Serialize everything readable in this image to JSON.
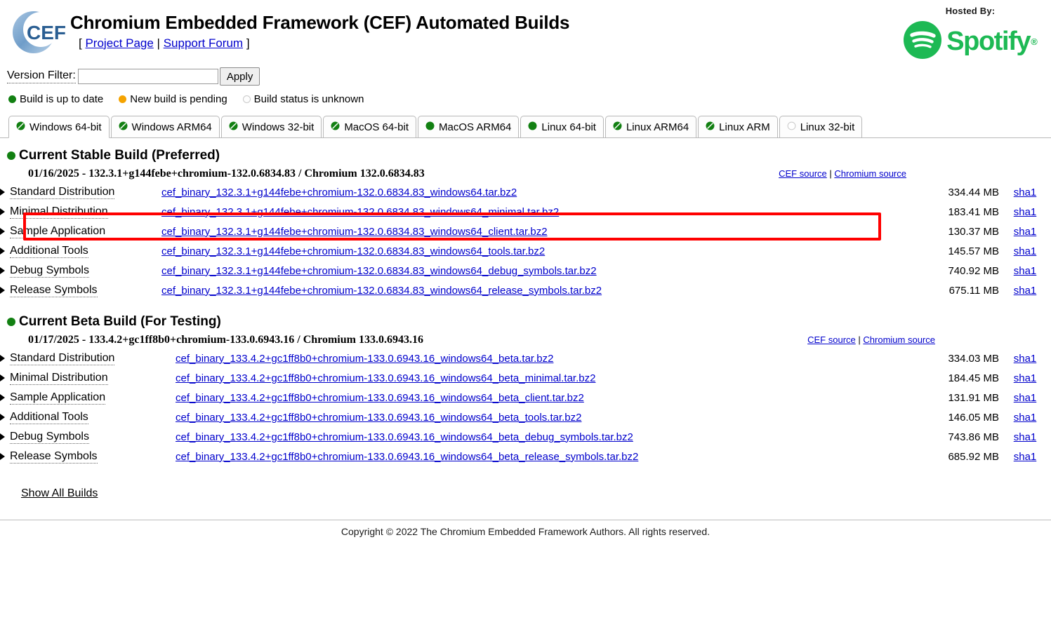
{
  "header": {
    "logo_alt": "CEF",
    "title": "Chromium Embedded Framework (CEF) Automated Builds",
    "bracket_open": "[",
    "bracket_close": "]",
    "pipe": "|",
    "project_page": "Project Page",
    "support_forum": "Support Forum",
    "hosted_by": "Hosted By:",
    "spotify": "Spotify",
    "spotify_reg": "®"
  },
  "filter": {
    "label": "Version Filter:",
    "value": "",
    "placeholder": "",
    "apply_label": "Apply"
  },
  "legend": [
    {
      "label": "Build is up to date",
      "status": "green"
    },
    {
      "label": "New build is pending",
      "status": "orange"
    },
    {
      "label": "Build status is unknown",
      "status": "unknown"
    }
  ],
  "tabs": [
    {
      "label": "Windows 64-bit",
      "status": "green-slash",
      "active": true
    },
    {
      "label": "Windows ARM64",
      "status": "green-slash",
      "active": false
    },
    {
      "label": "Windows 32-bit",
      "status": "green-slash",
      "active": false
    },
    {
      "label": "MacOS 64-bit",
      "status": "green-slash",
      "active": false
    },
    {
      "label": "MacOS ARM64",
      "status": "green",
      "active": false
    },
    {
      "label": "Linux 64-bit",
      "status": "green",
      "active": false
    },
    {
      "label": "Linux ARM64",
      "status": "green-slash",
      "active": false
    },
    {
      "label": "Linux ARM",
      "status": "green-slash",
      "active": false
    },
    {
      "label": "Linux 32-bit",
      "status": "unknown",
      "active": false
    }
  ],
  "sections": [
    {
      "heading": "Current Stable Build (Preferred)",
      "status": "green",
      "version_line": "01/16/2025 - 132.3.1+g144febe+chromium-132.0.6834.83 / Chromium 132.0.6834.83",
      "cef_source": "CEF source",
      "chromium_source": "Chromium source",
      "separator": "|",
      "rows": [
        {
          "label": "Standard Distribution",
          "file": "cef_binary_132.3.1+g144febe+chromium-132.0.6834.83_windows64.tar.bz2",
          "size": "334.44 MB",
          "sha": "sha1"
        },
        {
          "label": "Minimal Distribution",
          "file": "cef_binary_132.3.1+g144febe+chromium-132.0.6834.83_windows64_minimal.tar.bz2",
          "size": "183.41 MB",
          "sha": "sha1"
        },
        {
          "label": "Sample Application",
          "file": "cef_binary_132.3.1+g144febe+chromium-132.0.6834.83_windows64_client.tar.bz2",
          "size": "130.37 MB",
          "sha": "sha1"
        },
        {
          "label": "Additional Tools",
          "file": "cef_binary_132.3.1+g144febe+chromium-132.0.6834.83_windows64_tools.tar.bz2",
          "size": "145.57 MB",
          "sha": "sha1"
        },
        {
          "label": "Debug Symbols",
          "file": "cef_binary_132.3.1+g144febe+chromium-132.0.6834.83_windows64_debug_symbols.tar.bz2",
          "size": "740.92 MB",
          "sha": "sha1"
        },
        {
          "label": "Release Symbols",
          "file": "cef_binary_132.3.1+g144febe+chromium-132.0.6834.83_windows64_release_symbols.tar.bz2",
          "size": "675.11 MB",
          "sha": "sha1"
        }
      ]
    },
    {
      "heading": "Current Beta Build (For Testing)",
      "status": "green",
      "version_line": "01/17/2025 - 133.4.2+gc1ff8b0+chromium-133.0.6943.16 / Chromium 133.0.6943.16",
      "cef_source": "CEF source",
      "chromium_source": "Chromium source",
      "separator": "|",
      "rows": [
        {
          "label": "Standard Distribution",
          "file": "cef_binary_133.4.2+gc1ff8b0+chromium-133.0.6943.16_windows64_beta.tar.bz2",
          "size": "334.03 MB",
          "sha": "sha1"
        },
        {
          "label": "Minimal Distribution",
          "file": "cef_binary_133.4.2+gc1ff8b0+chromium-133.0.6943.16_windows64_beta_minimal.tar.bz2",
          "size": "184.45 MB",
          "sha": "sha1"
        },
        {
          "label": "Sample Application",
          "file": "cef_binary_133.4.2+gc1ff8b0+chromium-133.0.6943.16_windows64_beta_client.tar.bz2",
          "size": "131.91 MB",
          "sha": "sha1"
        },
        {
          "label": "Additional Tools",
          "file": "cef_binary_133.4.2+gc1ff8b0+chromium-133.0.6943.16_windows64_beta_tools.tar.bz2",
          "size": "146.05 MB",
          "sha": "sha1"
        },
        {
          "label": "Debug Symbols",
          "file": "cef_binary_133.4.2+gc1ff8b0+chromium-133.0.6943.16_windows64_beta_debug_symbols.tar.bz2",
          "size": "743.86 MB",
          "sha": "sha1"
        },
        {
          "label": "Release Symbols",
          "file": "cef_binary_133.4.2+gc1ff8b0+chromium-133.0.6943.16_windows64_beta_release_symbols.tar.bz2",
          "size": "685.92 MB",
          "sha": "sha1"
        }
      ]
    }
  ],
  "show_all_builds": "Show All Builds",
  "footer": "Copyright © 2022 The Chromium Embedded Framework Authors. All rights reserved.",
  "annotation": {
    "kind": "red-highlight-box",
    "target": "stable-standard-distribution-row",
    "color": "#ff0000"
  },
  "colors": {
    "link": "#0000cc",
    "status_green": "#128012",
    "status_orange": "#f5a300",
    "spotify_green": "#1db954",
    "annotation_red": "#ff0000"
  }
}
